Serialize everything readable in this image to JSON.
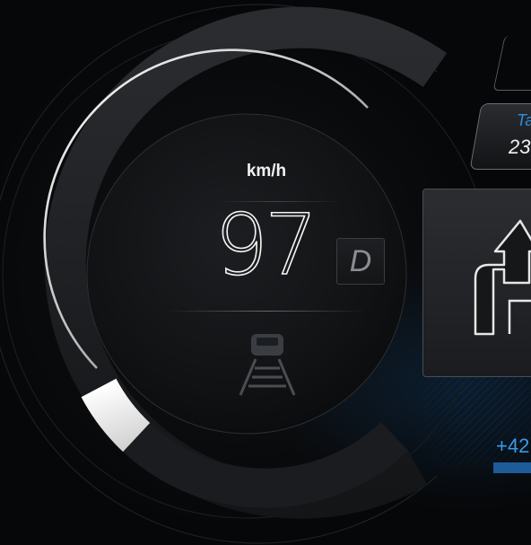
{
  "speedometer": {
    "unit": "km/h",
    "speed": "97",
    "gear": "D",
    "speed_fraction": 0.18
  },
  "side_info": {
    "label": "Ta",
    "value": "23"
  },
  "navigation": {
    "distance": "+42"
  },
  "colors": {
    "accent_blue": "#2a8fe0",
    "background": "#060708",
    "arc_silver": "#d8d8d8"
  },
  "icons": {
    "lane_assist": "car-on-road-icon",
    "turn": "turn-arrow-icon"
  }
}
